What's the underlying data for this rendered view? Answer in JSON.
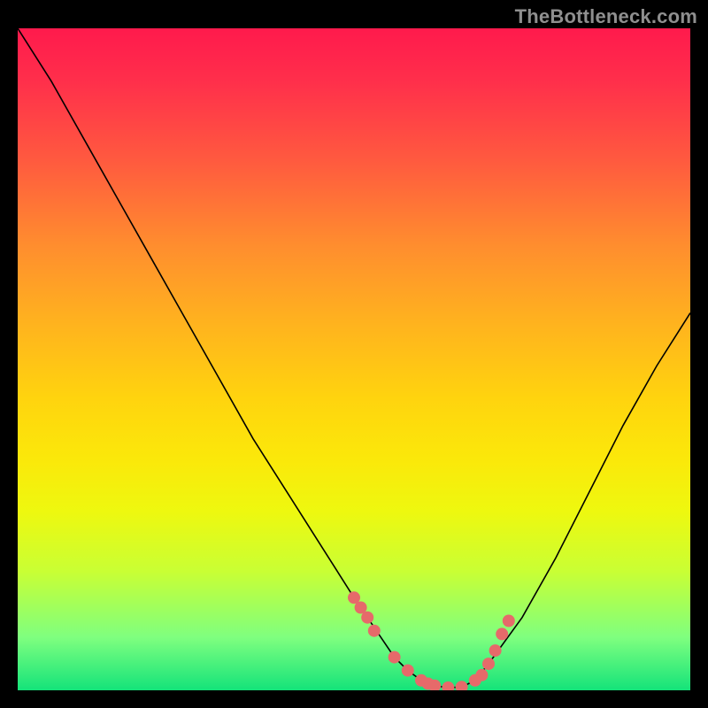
{
  "attribution": "TheBottleneck.com",
  "colors": {
    "dot": "#e66a6a",
    "curve": "#000000",
    "frame": "#000000"
  },
  "chart_data": {
    "type": "line",
    "title": "",
    "xlabel": "",
    "ylabel": "",
    "xlim": [
      0,
      100
    ],
    "ylim": [
      0,
      100
    ],
    "series": [
      {
        "name": "bottleneck-curve",
        "x": [
          0,
          5,
          10,
          15,
          20,
          25,
          30,
          35,
          40,
          45,
          50,
          52,
          54,
          56,
          58,
          60,
          62,
          64,
          66,
          68,
          70,
          75,
          80,
          85,
          90,
          95,
          100
        ],
        "y": [
          100,
          92,
          83,
          74,
          65,
          56,
          47,
          38,
          30,
          22,
          14,
          11,
          8,
          5,
          3,
          1.5,
          0.7,
          0.4,
          0.5,
          1.5,
          4,
          11,
          20,
          30,
          40,
          49,
          57
        ]
      }
    ],
    "highlight_points": {
      "name": "highlight-dots",
      "x": [
        50,
        51,
        52,
        53,
        56,
        58,
        60,
        61,
        62,
        64,
        66,
        68,
        69,
        70,
        71,
        72,
        73
      ],
      "y": [
        14,
        12.5,
        11,
        9,
        5,
        3,
        1.5,
        1,
        0.7,
        0.4,
        0.5,
        1.5,
        2.3,
        4,
        6,
        8.5,
        10.5
      ]
    }
  }
}
